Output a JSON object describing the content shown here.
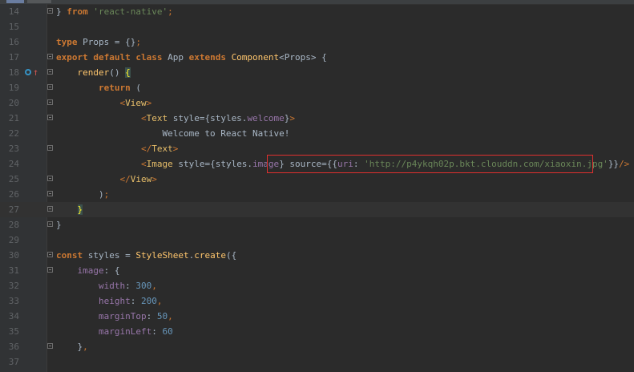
{
  "editor": {
    "lines": [
      {
        "n": "14",
        "tokens": [
          [
            "pl",
            "} "
          ],
          [
            "kw",
            "from"
          ],
          [
            "pl",
            " "
          ],
          [
            "str",
            "'react-native'"
          ],
          [
            "sym",
            ";"
          ]
        ]
      },
      {
        "n": "15",
        "tokens": []
      },
      {
        "n": "16",
        "tokens": [
          [
            "kw",
            "type"
          ],
          [
            "pl",
            " Props = {}"
          ],
          [
            "sym",
            ";"
          ]
        ]
      },
      {
        "n": "17",
        "tokens": [
          [
            "kw",
            "export default class"
          ],
          [
            "pl",
            " App "
          ],
          [
            "kw",
            "extends"
          ],
          [
            "pl",
            " "
          ],
          [
            "fn",
            "Component"
          ],
          [
            "pl",
            "<Props> {"
          ]
        ]
      },
      {
        "n": "18",
        "tokens": [
          [
            "pl",
            "    "
          ],
          [
            "fn",
            "render"
          ],
          [
            "pl",
            "() "
          ],
          [
            "brace-hl",
            "{"
          ]
        ]
      },
      {
        "n": "19",
        "tokens": [
          [
            "pl",
            "        "
          ],
          [
            "kw",
            "return"
          ],
          [
            "pl",
            " ("
          ]
        ]
      },
      {
        "n": "20",
        "tokens": [
          [
            "pl",
            "            "
          ],
          [
            "sym",
            "<"
          ],
          [
            "tag",
            "View"
          ],
          [
            "sym",
            ">"
          ]
        ]
      },
      {
        "n": "21",
        "tokens": [
          [
            "pl",
            "                "
          ],
          [
            "sym",
            "<"
          ],
          [
            "tag",
            "Text"
          ],
          [
            "pl",
            " style={styles."
          ],
          [
            "prop",
            "welcome"
          ],
          [
            "pl",
            "}"
          ],
          [
            "sym",
            ">"
          ]
        ]
      },
      {
        "n": "22",
        "tokens": [
          [
            "pl",
            "                    "
          ],
          [
            "jsxtext",
            "Welcome to React Native!"
          ]
        ]
      },
      {
        "n": "23",
        "tokens": [
          [
            "pl",
            "                "
          ],
          [
            "sym",
            "</"
          ],
          [
            "tag",
            "Text"
          ],
          [
            "sym",
            ">"
          ]
        ]
      },
      {
        "n": "24",
        "tokens": [
          [
            "pl",
            "                "
          ],
          [
            "sym",
            "<"
          ],
          [
            "tag",
            "Image"
          ],
          [
            "pl",
            " style={styles."
          ],
          [
            "prop",
            "image"
          ],
          [
            "pl",
            "} source={{"
          ],
          [
            "prop",
            "uri"
          ],
          [
            "pl",
            ": "
          ],
          [
            "str",
            "'http://p4ykqh02p.bkt.clouddn.com/xiaoxin.jpg'"
          ],
          [
            "pl",
            "}}"
          ],
          [
            "sym",
            "/>"
          ]
        ]
      },
      {
        "n": "25",
        "tokens": [
          [
            "pl",
            "            "
          ],
          [
            "sym",
            "</"
          ],
          [
            "tag",
            "View"
          ],
          [
            "sym",
            ">"
          ]
        ]
      },
      {
        "n": "26",
        "tokens": [
          [
            "pl",
            "        )"
          ],
          [
            "sym",
            ";"
          ]
        ]
      },
      {
        "n": "27",
        "tokens": [
          [
            "pl",
            "    "
          ],
          [
            "brace-hl",
            "}"
          ]
        ]
      },
      {
        "n": "28",
        "tokens": [
          [
            "pl",
            "}"
          ]
        ]
      },
      {
        "n": "29",
        "tokens": []
      },
      {
        "n": "30",
        "tokens": [
          [
            "kw",
            "const"
          ],
          [
            "pl",
            " styles = "
          ],
          [
            "fn",
            "StyleSheet"
          ],
          [
            "pl",
            "."
          ],
          [
            "fn",
            "create"
          ],
          [
            "pl",
            "({"
          ]
        ]
      },
      {
        "n": "31",
        "tokens": [
          [
            "pl",
            "    "
          ],
          [
            "prop",
            "image"
          ],
          [
            "pl",
            ": {"
          ]
        ]
      },
      {
        "n": "32",
        "tokens": [
          [
            "pl",
            "        "
          ],
          [
            "prop",
            "width"
          ],
          [
            "pl",
            ": "
          ],
          [
            "num",
            "300"
          ],
          [
            "sym",
            ","
          ]
        ]
      },
      {
        "n": "33",
        "tokens": [
          [
            "pl",
            "        "
          ],
          [
            "prop",
            "height"
          ],
          [
            "pl",
            ": "
          ],
          [
            "num",
            "200"
          ],
          [
            "sym",
            ","
          ]
        ]
      },
      {
        "n": "34",
        "tokens": [
          [
            "pl",
            "        "
          ],
          [
            "prop",
            "marginTop"
          ],
          [
            "pl",
            ": "
          ],
          [
            "num",
            "50"
          ],
          [
            "sym",
            ","
          ]
        ]
      },
      {
        "n": "35",
        "tokens": [
          [
            "pl",
            "        "
          ],
          [
            "prop",
            "marginLeft"
          ],
          [
            "pl",
            ": "
          ],
          [
            "num",
            "60"
          ]
        ]
      },
      {
        "n": "36",
        "tokens": [
          [
            "pl",
            "    }"
          ],
          [
            "sym",
            ","
          ]
        ]
      },
      {
        "n": "37",
        "tokens": []
      }
    ],
    "caret_line": "27",
    "folds": {
      "14": "open",
      "17": "open",
      "18": "open",
      "19": "open",
      "20": "open",
      "21": "open",
      "23": "open",
      "25": "open",
      "26": "open",
      "27": "open",
      "28": "open",
      "30": "open",
      "31": "open",
      "36": "open"
    }
  },
  "colors": {
    "background": "#2b2b2b",
    "gutter": "#313335",
    "keyword": "#cc7832",
    "string": "#6a8759",
    "number": "#6897bb",
    "function": "#ffc66d",
    "tag": "#e8bf6a",
    "property": "#9876aa",
    "highlight_box": "#e0302e"
  },
  "gutter_icon": "override-method-icon"
}
